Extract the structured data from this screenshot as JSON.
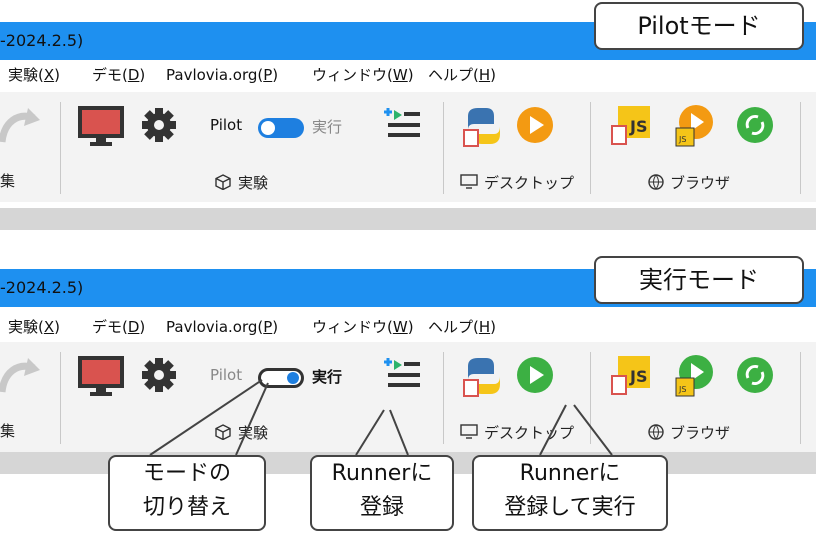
{
  "window": {
    "title_fragment": "-2024.2.5)"
  },
  "menu": [
    {
      "label": "実験(",
      "key": "X",
      "suffix": ")"
    },
    {
      "label": "デモ(",
      "key": "D",
      "suffix": ")"
    },
    {
      "label": "Pavlovia.org(",
      "key": "P",
      "suffix": ")"
    },
    {
      "label": "ウィンドウ(",
      "key": "W",
      "suffix": ")"
    },
    {
      "label": "ヘルプ(",
      "key": "H",
      "suffix": ")"
    }
  ],
  "toolbar": {
    "edit_label_fragment": "集",
    "pilot_label": "Pilot",
    "run_label": "実行",
    "experiment_group": "実験",
    "desktop_group": "デスクトップ",
    "browser_group": "ブラウザ",
    "js_badge": "JS"
  },
  "panels": [
    {
      "mode_callout": "Pilotモード",
      "mode": "pilot",
      "play_color": "#f39a12"
    },
    {
      "mode_callout": "実行モード",
      "mode": "run",
      "play_color": "#3cb043"
    }
  ],
  "notes": {
    "toggle": "モードの\n切り替え",
    "runner_add": "Runnerに\n登録",
    "runner_run": "Runnerに\n登録して実行"
  },
  "colors": {
    "titlebar": "#1e90f0",
    "toggle_accent": "#1e7fe0",
    "sync_green": "#3cb043",
    "js_yellow": "#f5c518"
  }
}
